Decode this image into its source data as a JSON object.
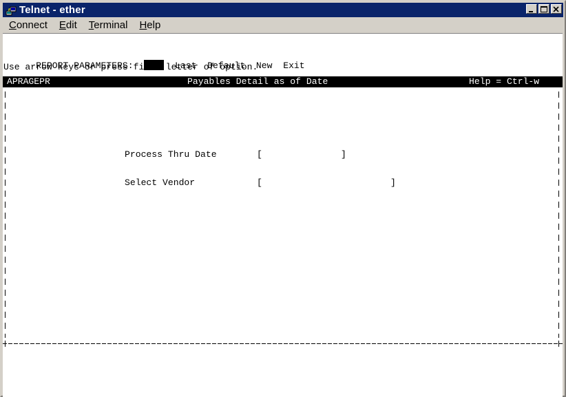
{
  "window": {
    "title": "Telnet - ether"
  },
  "menu": [
    {
      "label_u": "C",
      "label_rest": "onnect"
    },
    {
      "label_u": "E",
      "label_rest": "dit"
    },
    {
      "label_u": "T",
      "label_rest": "erminal"
    },
    {
      "label_u": "H",
      "label_rest": "elp"
    }
  ],
  "terminal": {
    "params_label": "REPORT PARAMETERS:",
    "options": [
      "Last",
      "Default",
      "New",
      "Exit"
    ],
    "hint": "Use arrow keys or press first letter of option.",
    "header": {
      "program": "APRAGEPR",
      "title": "Payables Detail as of Date",
      "help": "Help = Ctrl-w"
    },
    "fields": [
      {
        "label": "Process Thru Date",
        "value": ""
      },
      {
        "label": "Select Vendor",
        "value": ""
      }
    ]
  },
  "colors": {
    "titlebar": "#0a246a",
    "terminal_bg": "#ffffff",
    "terminal_fg": "#000000"
  }
}
